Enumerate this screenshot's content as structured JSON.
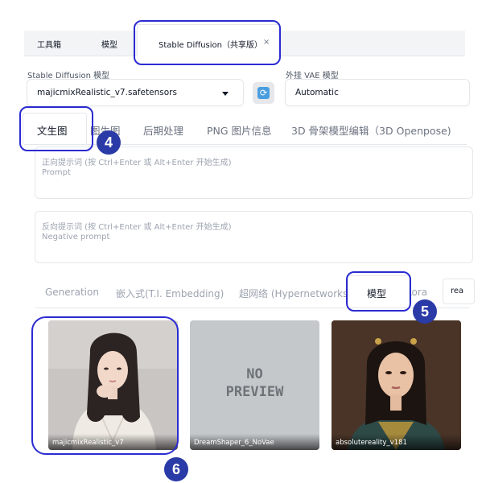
{
  "top_tabs": {
    "toolbox": "工具箱",
    "model": "模型",
    "active": "Stable Diffusion（共享版）",
    "close_glyph": "×"
  },
  "sd_model": {
    "label": "Stable Diffusion 模型",
    "value": "majicmixRealistic_v7.safetensors"
  },
  "vae": {
    "label": "外挂 VAE 模型",
    "value": "Automatic"
  },
  "function_tabs": [
    "文生图",
    "图生图",
    "后期处理",
    "PNG 图片信息",
    "3D 骨架模型编辑（3D Openpose)"
  ],
  "positive_prompt": {
    "hint": "正向提示词 (按 Ctrl+Enter 或 Alt+Enter 开始生成)",
    "placeholder": "Prompt"
  },
  "negative_prompt": {
    "hint": "反向提示词 (按 Ctrl+Enter 或 Alt+Enter 开始生成)",
    "placeholder": "Negative prompt"
  },
  "network_tabs": [
    "Generation",
    "嵌入式(T.I. Embedding)",
    "超网络 (Hypernetworks)",
    "模型",
    "Lora"
  ],
  "search": {
    "value": "rea"
  },
  "cards": [
    {
      "name": "majicmixRealistic_v7"
    },
    {
      "name": "DreamShaper_6_NoVae",
      "placeholder_lines": [
        "NO",
        "PREVIEW"
      ]
    },
    {
      "name": "absolutereality_v181"
    }
  ],
  "badges": [
    "4",
    "5",
    "6"
  ],
  "colors": {
    "callout": "#2b2bd1",
    "badge": "#2a3aa6",
    "refresh": "#4a9ee0"
  }
}
